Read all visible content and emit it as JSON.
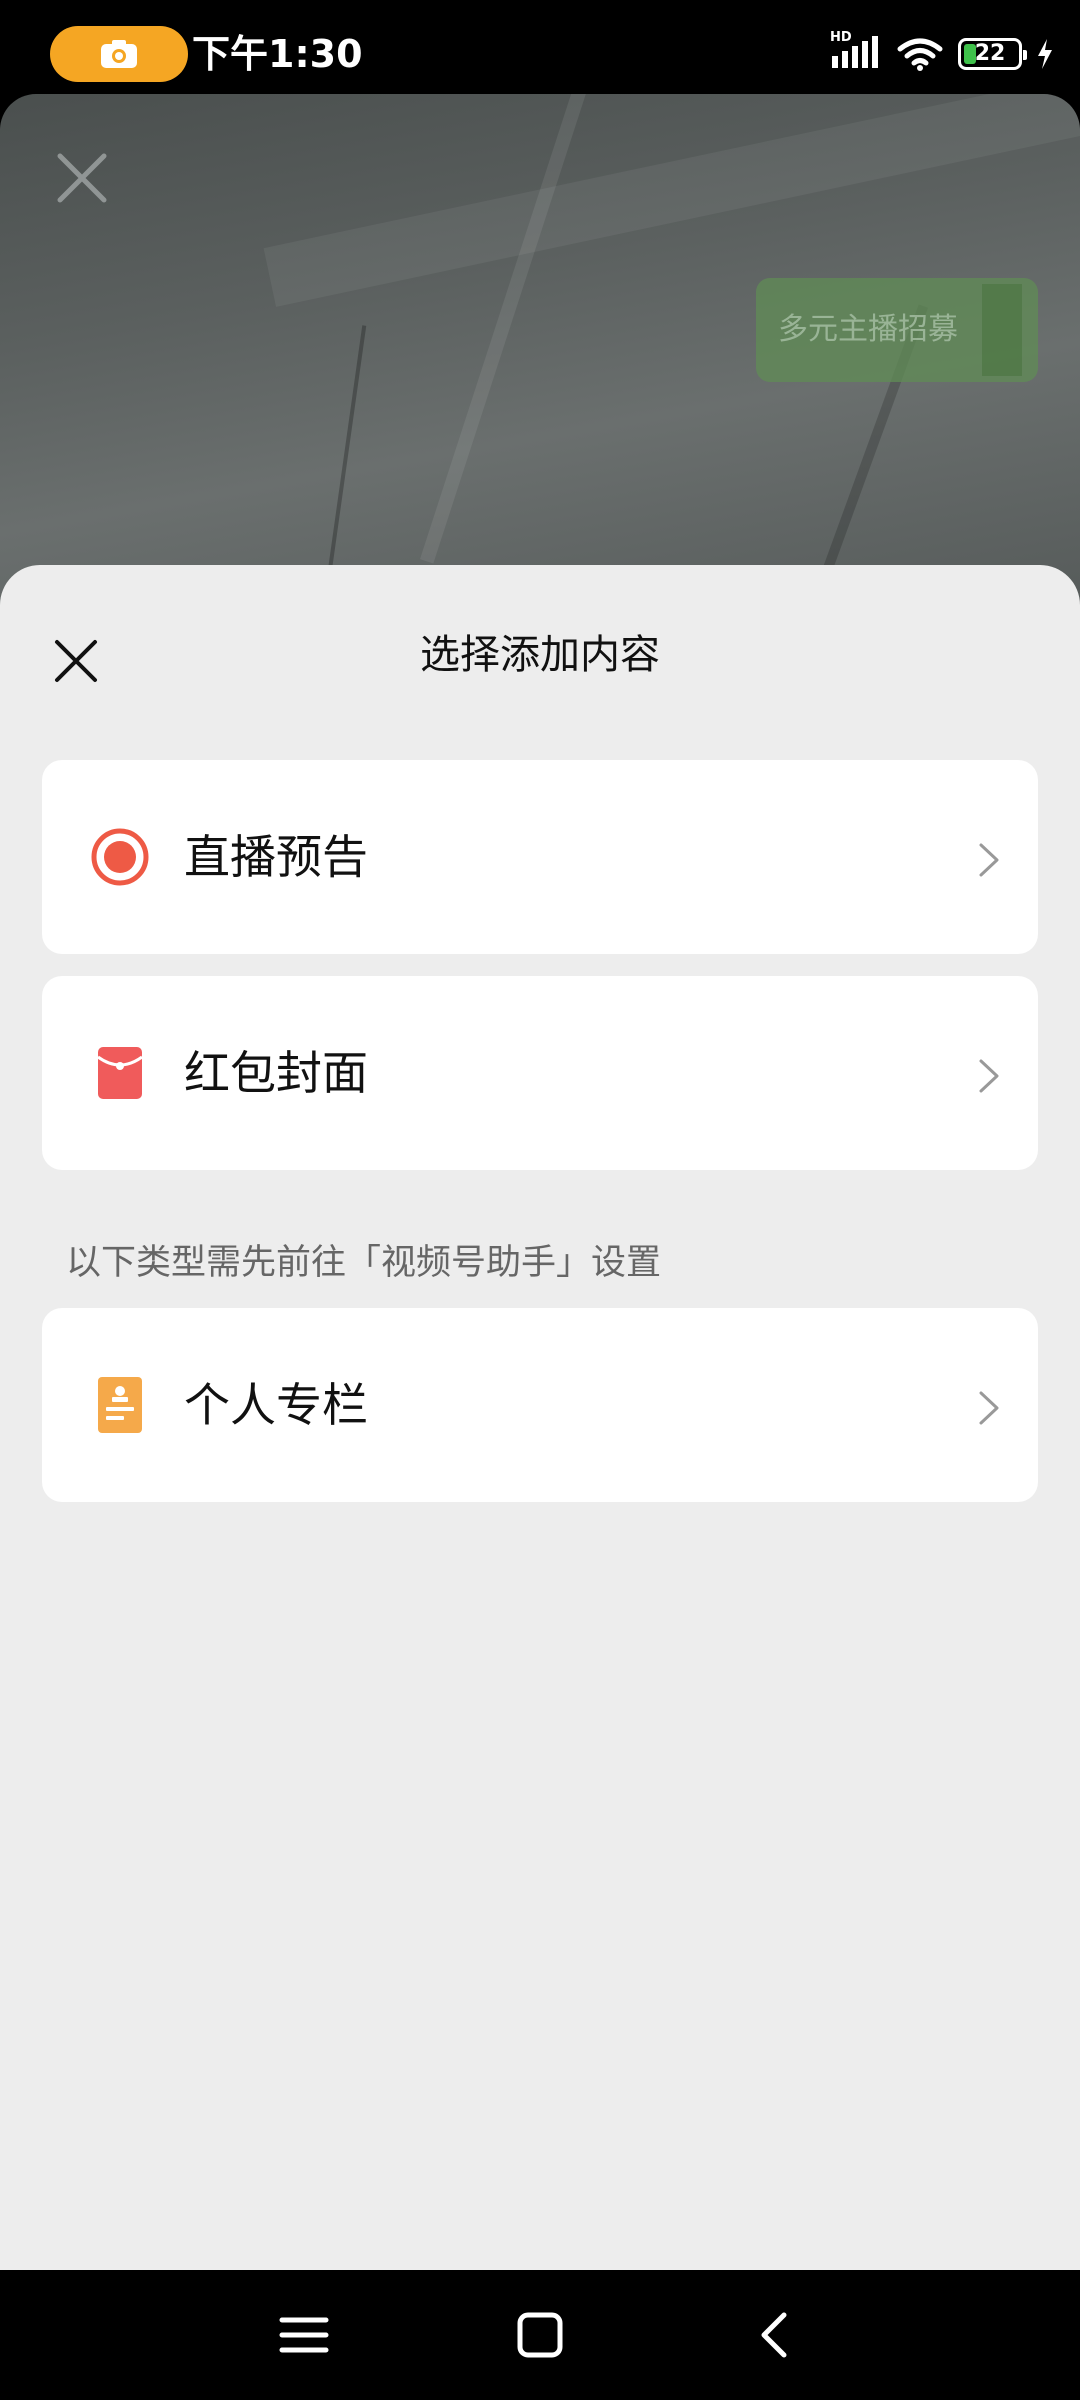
{
  "status_bar": {
    "time": "下午1:30",
    "network_label": "HD",
    "battery_level": "22"
  },
  "preview": {
    "recruit_button_label": "多元主播招募"
  },
  "sheet": {
    "title": "选择添加内容",
    "items": [
      {
        "label": "直播预告",
        "icon": "live-record-icon",
        "color": "#ee5a45"
      },
      {
        "label": "红包封面",
        "icon": "red-envelope-icon",
        "color": "#f05b5b"
      }
    ],
    "section_hint": "以下类型需先前往「视频号助手」设置",
    "assistant_items": [
      {
        "label": "个人专栏",
        "icon": "column-document-icon",
        "color": "#f5a94a"
      }
    ]
  },
  "nav_bar": {
    "buttons": [
      "menu-icon",
      "home-icon",
      "back-icon"
    ]
  },
  "colors": {
    "accent_orange": "#f5a623",
    "sheet_bg": "#ededed",
    "card_bg": "#ffffff"
  }
}
